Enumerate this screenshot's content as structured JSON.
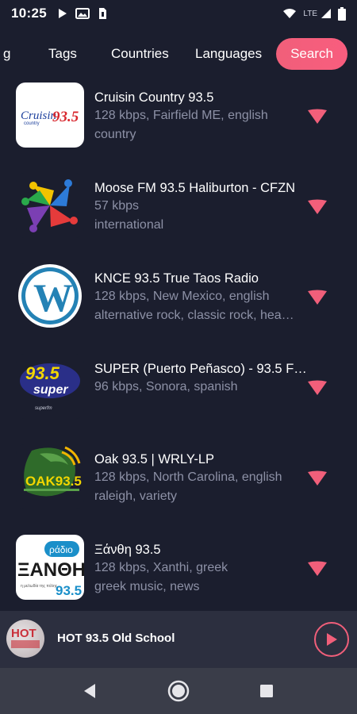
{
  "status_bar": {
    "time": "10:25",
    "network_label": "LTE"
  },
  "tabs": {
    "partial": "g",
    "tags": "Tags",
    "countries": "Countries",
    "languages": "Languages",
    "search": "Search"
  },
  "stations": [
    {
      "name": "Cruisin Country 93.5",
      "line1": "128 kbps, Fairfield ME, english",
      "line2": "country",
      "logo_text": "Cruisin Country 93.5"
    },
    {
      "name": "Moose FM 93.5 Haliburton - CFZN",
      "line1": "57 kbps",
      "line2": "international"
    },
    {
      "name": "KNCE 93.5 True Taos Radio",
      "line1": "128 kbps, New Mexico, english",
      "line2": "alternative rock, classic rock, hea…"
    },
    {
      "name": "SUPER (Puerto Peñasco) - 93.5 F…",
      "line1": "96 kbps, Sonora, spanish",
      "line2": "",
      "logo_text": "93.5 super"
    },
    {
      "name": "Oak 93.5 | WRLY-LP",
      "line1": "128 kbps, North Carolina, english",
      "line2": "raleigh, variety",
      "logo_text": "OAK 93.5"
    },
    {
      "name": "Ξάνθη 93.5",
      "line1": "128 kbps, Xanthi, greek",
      "line2": "greek music, news",
      "logo_text": "ράδιο ΞΑΝΘΗ 93.5"
    }
  ],
  "player": {
    "title": "HOT 93.5 Old School",
    "thumb_text": "HOT"
  },
  "colors": {
    "background": "#1b1e2e",
    "accent": "#f15f7a",
    "player_bg": "#2c2f3f",
    "nav_bg": "#3a3d49"
  }
}
